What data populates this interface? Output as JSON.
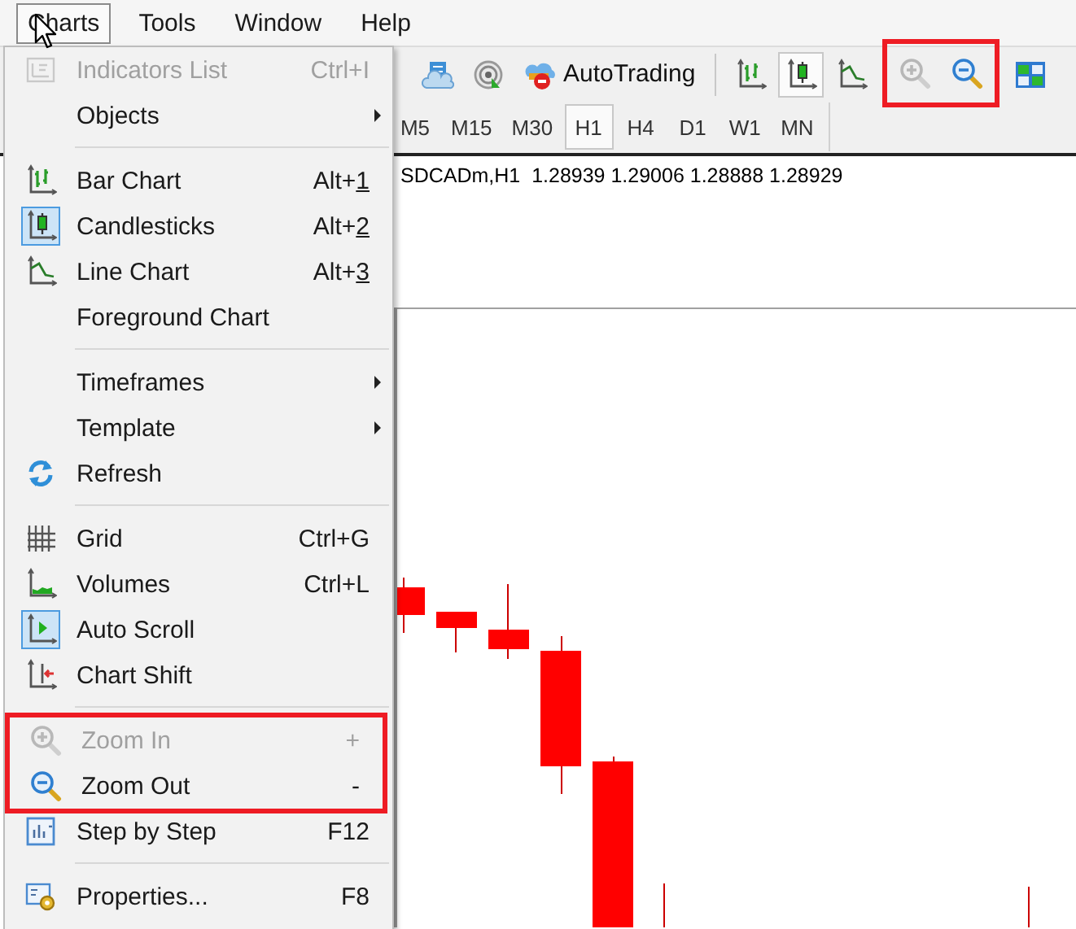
{
  "menubar": [
    {
      "label": "Charts",
      "selected": true
    },
    {
      "label": "Tools",
      "selected": false
    },
    {
      "label": "Window",
      "selected": false
    },
    {
      "label": "Help",
      "selected": false
    }
  ],
  "toolbar": {
    "items": [
      {
        "kind": "icon",
        "selected": false,
        "disabled": false
      },
      {
        "kind": "icon",
        "selected": false,
        "disabled": false
      },
      {
        "kind": "button",
        "label": "AutoTrading",
        "selected": false,
        "disabled": false
      },
      {
        "kind": "separator"
      },
      {
        "kind": "icon",
        "selected": false,
        "disabled": false
      },
      {
        "kind": "icon",
        "selected": true,
        "disabled": false
      },
      {
        "kind": "icon",
        "selected": false,
        "disabled": false
      },
      {
        "kind": "highlight",
        "items": [
          {
            "kind": "icon",
            "selected": false,
            "disabled": true
          },
          {
            "kind": "icon",
            "selected": false,
            "disabled": false
          }
        ]
      },
      {
        "kind": "icon",
        "selected": false,
        "disabled": false
      }
    ]
  },
  "timeframes": [
    {
      "label": "M5",
      "selected": false
    },
    {
      "label": "M15",
      "selected": false
    },
    {
      "label": "M30",
      "selected": false
    },
    {
      "label": "H1",
      "selected": true
    },
    {
      "label": "H4",
      "selected": false
    },
    {
      "label": "D1",
      "selected": false
    },
    {
      "label": "W1",
      "selected": false
    },
    {
      "label": "MN",
      "selected": false
    }
  ],
  "chart": {
    "legend": "SDCADm,H1  1.28939 1.29006 1.28888 1.28929"
  },
  "menu": {
    "items": [
      {
        "kind": "item",
        "label": "Indicators List",
        "shortcut": "Ctrl+I",
        "mnemonic_underlined": false,
        "disabled": true,
        "checked": false,
        "submenu": false
      },
      {
        "kind": "item",
        "label": "Objects",
        "disabled": false,
        "checked": false,
        "submenu": true
      },
      {
        "kind": "separator"
      },
      {
        "kind": "item",
        "label": "Bar Chart",
        "shortcut": "Alt+1",
        "mnemonic_underlined": true,
        "disabled": false,
        "checked": false,
        "submenu": false
      },
      {
        "kind": "item",
        "label": "Candlesticks",
        "shortcut": "Alt+2",
        "mnemonic_underlined": true,
        "disabled": false,
        "checked": true,
        "submenu": false
      },
      {
        "kind": "item",
        "label": "Line Chart",
        "shortcut": "Alt+3",
        "mnemonic_underlined": true,
        "disabled": false,
        "checked": false,
        "submenu": false
      },
      {
        "kind": "item",
        "label": "Foreground Chart",
        "disabled": false,
        "checked": false,
        "submenu": false
      },
      {
        "kind": "separator"
      },
      {
        "kind": "item",
        "label": "Timeframes",
        "disabled": false,
        "checked": false,
        "submenu": true
      },
      {
        "kind": "item",
        "label": "Template",
        "disabled": false,
        "checked": false,
        "submenu": true
      },
      {
        "kind": "item",
        "label": "Refresh",
        "disabled": false,
        "checked": false,
        "submenu": false
      },
      {
        "kind": "separator"
      },
      {
        "kind": "item",
        "label": "Grid",
        "shortcut": "Ctrl+G",
        "mnemonic_underlined": false,
        "disabled": false,
        "checked": false,
        "submenu": false
      },
      {
        "kind": "item",
        "label": "Volumes",
        "shortcut": "Ctrl+L",
        "mnemonic_underlined": false,
        "disabled": false,
        "checked": false,
        "submenu": false
      },
      {
        "kind": "item",
        "label": "Auto Scroll",
        "disabled": false,
        "checked": true,
        "submenu": false
      },
      {
        "kind": "item",
        "label": "Chart Shift",
        "disabled": false,
        "checked": false,
        "submenu": false
      },
      {
        "kind": "separator"
      },
      {
        "kind": "highlight",
        "items": [
          {
            "kind": "item",
            "label": "Zoom In",
            "shortcut": "+",
            "mnemonic_underlined": false,
            "disabled": true,
            "checked": false,
            "submenu": false
          },
          {
            "kind": "item",
            "label": "Zoom Out",
            "shortcut": "-",
            "mnemonic_underlined": false,
            "disabled": false,
            "checked": false,
            "submenu": false
          }
        ]
      },
      {
        "kind": "item",
        "label": "Step by Step",
        "shortcut": "F12",
        "mnemonic_underlined": false,
        "disabled": false,
        "checked": false,
        "submenu": false
      },
      {
        "kind": "separator"
      },
      {
        "kind": "item",
        "label": "Properties...",
        "shortcut": "F8",
        "mnemonic_underlined": false,
        "disabled": false,
        "checked": false,
        "submenu": false
      }
    ]
  }
}
